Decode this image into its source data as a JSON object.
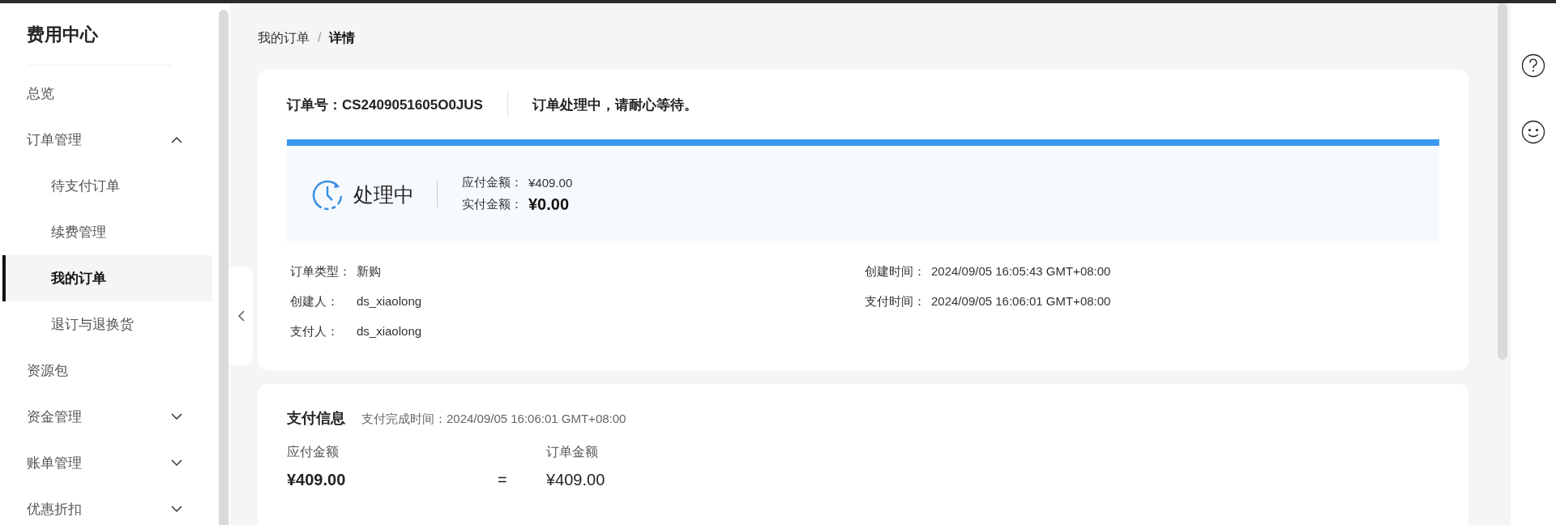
{
  "sidebar": {
    "title": "费用中心",
    "items": [
      {
        "label": "总览",
        "selected": false
      },
      {
        "label": "订单管理",
        "selected": false,
        "expanded": true,
        "children": [
          {
            "label": "待支付订单",
            "selected": false
          },
          {
            "label": "续费管理",
            "selected": false
          },
          {
            "label": "我的订单",
            "selected": true
          },
          {
            "label": "退订与退换货",
            "selected": false
          }
        ]
      },
      {
        "label": "资源包",
        "selected": false
      },
      {
        "label": "资金管理",
        "selected": false,
        "expanded": false
      },
      {
        "label": "账单管理",
        "selected": false,
        "expanded": false
      },
      {
        "label": "优惠折扣",
        "selected": false,
        "expanded": false
      }
    ]
  },
  "breadcrumb": {
    "separator": "/",
    "items": [
      "我的订单",
      "详情"
    ]
  },
  "order": {
    "number": "订单号：CS2409051605O0JUS",
    "message": "订单处理中，请耐心等待。",
    "status": "处理中",
    "amounts": [
      {
        "label": "应付金额：",
        "value": "¥409.00",
        "emphasis": false
      },
      {
        "label": "实付金额：",
        "value": "¥0.00",
        "emphasis": true
      }
    ],
    "details_left": [
      {
        "label": "订单类型：",
        "value": "新购"
      },
      {
        "label": "创建人：",
        "value": "ds_xiaolong"
      },
      {
        "label": "支付人：",
        "value": "ds_xiaolong"
      }
    ],
    "details_right": [
      {
        "label": "创建时间：",
        "value": "2024/09/05 16:05:43 GMT+08:00"
      },
      {
        "label": "支付时间：",
        "value": "2024/09/05 16:06:01 GMT+08:00"
      }
    ]
  },
  "payment": {
    "title": "支付信息",
    "completed": "支付完成时间：2024/09/05 16:06:01 GMT+08:00",
    "payable_label": "应付金额",
    "payable_value": "¥409.00",
    "operator": "=",
    "order_label": "订单金额",
    "order_value": "¥409.00"
  }
}
